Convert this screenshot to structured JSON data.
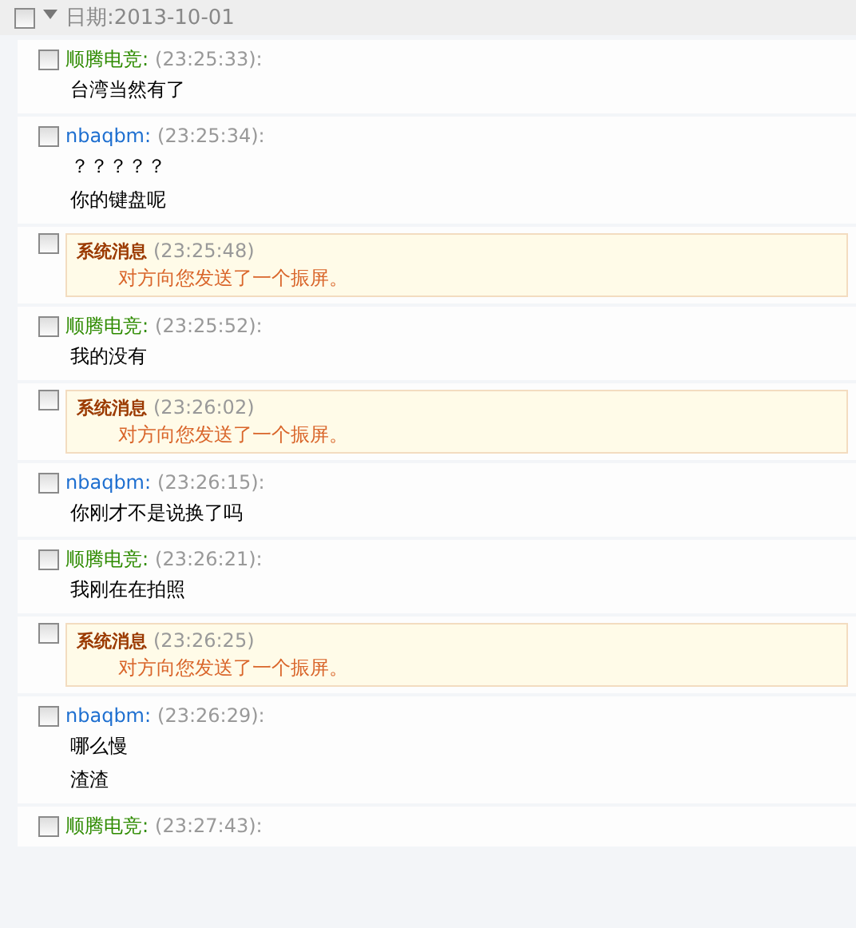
{
  "date_header": {
    "label": "日期:2013-10-01",
    "checked": false,
    "expanded": true
  },
  "messages": [
    {
      "kind": "user",
      "checked": false,
      "sender": "顺腾电竞:",
      "color": "#2e8b00",
      "time": "(23:25:33):",
      "lines": [
        "台湾当然有了"
      ]
    },
    {
      "kind": "user",
      "checked": false,
      "sender": "nbaqbm:",
      "color": "#1e6fd0",
      "time": "(23:25:34):",
      "lines": [
        "？？？？？",
        "你的键盘呢"
      ]
    },
    {
      "kind": "system",
      "checked": false,
      "label": "系统消息",
      "time": "(23:25:48)",
      "text": "对方向您发送了一个振屏。"
    },
    {
      "kind": "user",
      "checked": false,
      "sender": "顺腾电竞:",
      "color": "#2e8b00",
      "time": "(23:25:52):",
      "lines": [
        "我的没有"
      ]
    },
    {
      "kind": "system",
      "checked": false,
      "label": "系统消息",
      "time": "(23:26:02)",
      "text": "对方向您发送了一个振屏。"
    },
    {
      "kind": "user",
      "checked": false,
      "sender": "nbaqbm:",
      "color": "#1e6fd0",
      "time": "(23:26:15):",
      "lines": [
        "你刚才不是说换了吗"
      ]
    },
    {
      "kind": "user",
      "checked": false,
      "sender": "顺腾电竞:",
      "color": "#2e8b00",
      "time": "(23:26:21):",
      "lines": [
        "我刚在在拍照"
      ]
    },
    {
      "kind": "system",
      "checked": false,
      "label": "系统消息",
      "time": "(23:26:25)",
      "text": "对方向您发送了一个振屏。"
    },
    {
      "kind": "user",
      "checked": false,
      "sender": "nbaqbm:",
      "color": "#1e6fd0",
      "time": "(23:26:29):",
      "lines": [
        "哪么慢",
        "渣渣"
      ]
    },
    {
      "kind": "user",
      "checked": false,
      "sender": "顺腾电竞:",
      "color": "#2e8b00",
      "time": "(23:27:43):"
    }
  ]
}
